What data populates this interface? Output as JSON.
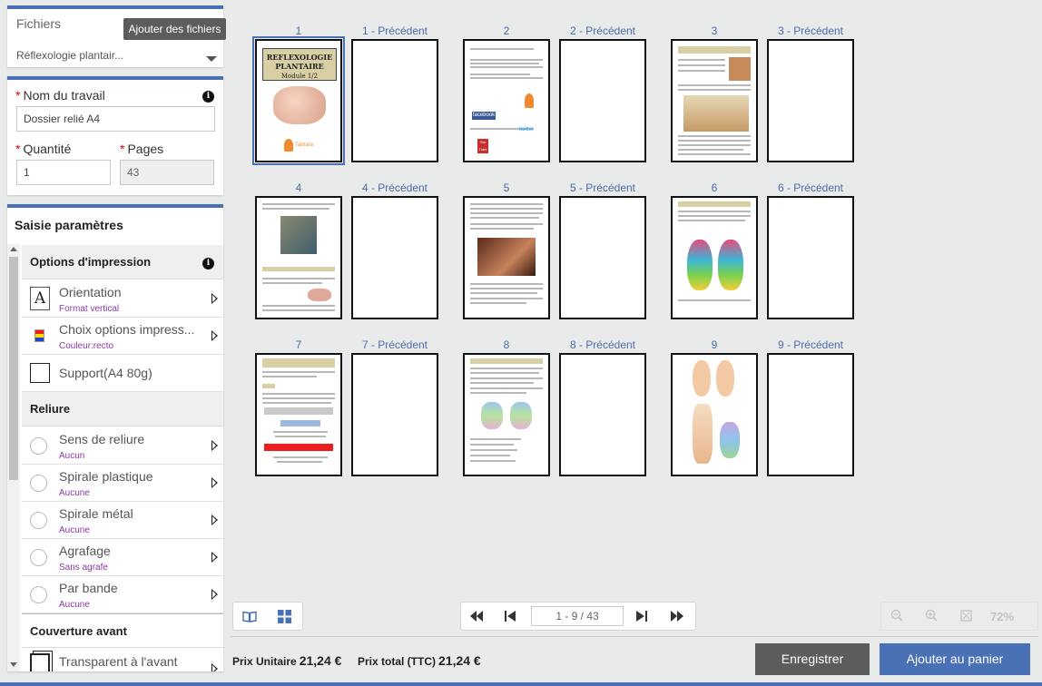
{
  "files": {
    "title": "Fichiers",
    "add_button": "Ajouter des fichiers",
    "selected_file": "Réflexologie plantair..."
  },
  "job": {
    "name_label": "Nom du travail",
    "name_value": "Dossier relié A4",
    "quantity_label": "Quantité",
    "quantity_value": "1",
    "pages_label": "Pages",
    "pages_value": "43",
    "required_mark": "*",
    "info_glyph": "i"
  },
  "params": {
    "title": "Saisie paramètres",
    "print_options": {
      "heading": "Options d'impression",
      "items": [
        {
          "label": "Orientation",
          "sub": "Format vertical",
          "icon": "orientation-icon",
          "glyph": "A"
        },
        {
          "label": "Choix options impress...",
          "sub": "Couleur:recto",
          "icon": "color-options-icon"
        },
        {
          "label": "Support(A4 80g)",
          "sub": "",
          "icon": "paper-support-icon"
        }
      ]
    },
    "binding": {
      "heading": "Reliure",
      "items": [
        {
          "label": "Sens de reliure",
          "sub": "Aucun"
        },
        {
          "label": "Spirale plastique",
          "sub": "Aucune"
        },
        {
          "label": "Spirale métal",
          "sub": "Aucune"
        },
        {
          "label": "Agrafage",
          "sub": "Sans agrafe"
        },
        {
          "label": "Par bande",
          "sub": "Aucune"
        }
      ]
    },
    "cover": {
      "heading": "Couverture avant",
      "items": [
        {
          "label": "Transparent à l'avant",
          "icon": "transparent-cover-icon"
        }
      ]
    }
  },
  "pages": [
    {
      "label": "1",
      "back_label": "1 - Précédent",
      "cover_title": "REFLEXOLOGIE PLANTAIRE",
      "cover_sub": "Module 1/2",
      "brand": "Tamara"
    },
    {
      "label": "2",
      "back_label": "2 - Précédent",
      "logos": [
        "facebook",
        "twitter",
        "You Tube"
      ]
    },
    {
      "label": "3",
      "back_label": "3 - Précédent"
    },
    {
      "label": "4",
      "back_label": "4 - Précédent"
    },
    {
      "label": "5",
      "back_label": "5 - Précédent"
    },
    {
      "label": "6",
      "back_label": "6 - Précédent"
    },
    {
      "label": "7",
      "back_label": "7 - Précédent"
    },
    {
      "label": "8",
      "back_label": "8 - Précédent"
    },
    {
      "label": "9",
      "back_label": "9 - Précédent"
    }
  ],
  "navigation": {
    "page_counter": "1 - 9 / 43",
    "zoom": "72%"
  },
  "footer": {
    "unit_price_label": "Prix Unitaire",
    "unit_price": "21,24 €",
    "total_price_label": "Prix total (TTC)",
    "total_price": "21,24 €",
    "save_button": "Enregistrer",
    "cart_button": "Ajouter au panier"
  },
  "colors": {
    "accent": "#4a70b5",
    "dark_button": "#5c5c5c",
    "sub_text": "#8a3aa1",
    "required": "#dd0000"
  }
}
